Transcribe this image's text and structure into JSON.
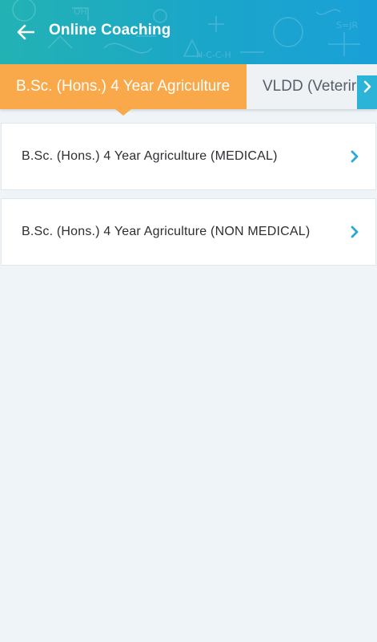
{
  "header": {
    "title": "Online Coaching",
    "back_icon": "back-arrow-icon",
    "background_colors": [
      "#23b2b4",
      "#1aa0d8"
    ]
  },
  "tabs": {
    "items": [
      {
        "label": "B.Sc. (Hons.) 4 Year Agriculture",
        "active": true
      },
      {
        "label": "VLDD (Veterir",
        "active": false
      }
    ],
    "active_color": "#f9a84a",
    "scroll_icon": "chevron-right-icon"
  },
  "courses": {
    "items": [
      {
        "label": "B.Sc. (Hons.) 4 Year Agriculture (MEDICAL)"
      },
      {
        "label": "B.Sc. (Hons.) 4 Year Agriculture (NON MEDICAL)"
      }
    ],
    "chevron_color": "#29a9d6",
    "item_icon": "chevron-right-icon"
  }
}
